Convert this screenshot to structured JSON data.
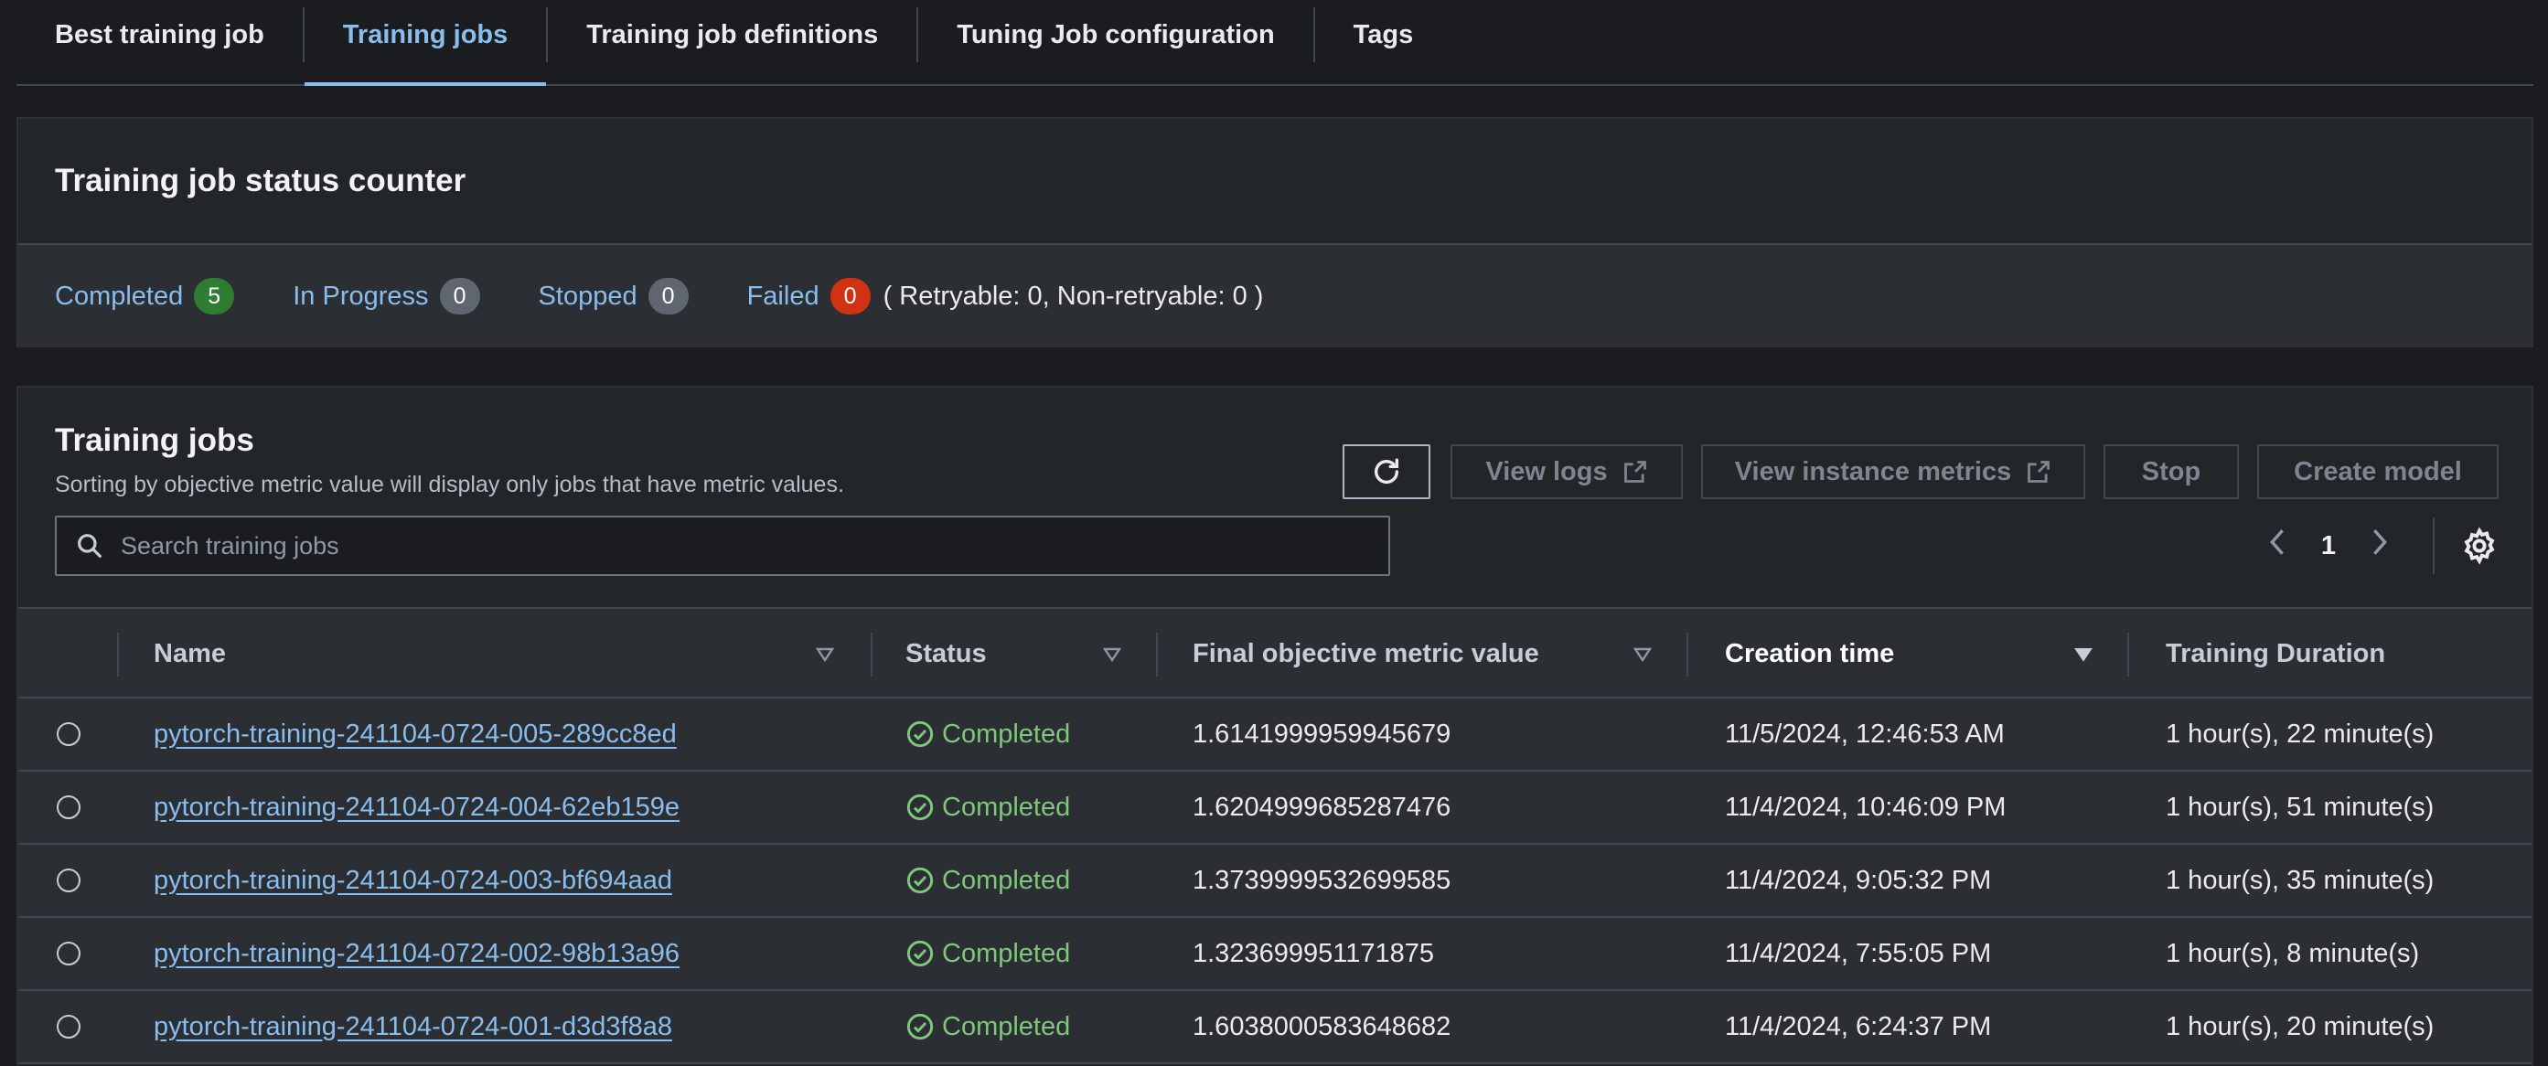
{
  "tabs": [
    {
      "label": "Best training job",
      "active": false
    },
    {
      "label": "Training jobs",
      "active": true
    },
    {
      "label": "Training job definitions",
      "active": false
    },
    {
      "label": "Tuning Job configuration",
      "active": false
    },
    {
      "label": "Tags",
      "active": false
    }
  ],
  "status_counter": {
    "title": "Training job status counter",
    "completed": {
      "label": "Completed",
      "count": "5"
    },
    "in_progress": {
      "label": "In Progress",
      "count": "0"
    },
    "stopped": {
      "label": "Stopped",
      "count": "0"
    },
    "failed": {
      "label": "Failed",
      "count": "0"
    },
    "retry_text": "( Retryable: 0, Non-retryable: 0 )"
  },
  "jobs": {
    "title": "Training jobs",
    "description": "Sorting by objective metric value will display only jobs that have metric values.",
    "buttons": {
      "view_logs": "View logs",
      "view_metrics": "View instance metrics",
      "stop": "Stop",
      "create_model": "Create model"
    },
    "search_placeholder": "Search training jobs",
    "page": "1",
    "columns": {
      "name": "Name",
      "status": "Status",
      "metric": "Final objective metric value",
      "created": "Creation time",
      "duration": "Training Duration"
    },
    "rows": [
      {
        "name": "pytorch-training-241104-0724-005-289cc8ed",
        "status": "Completed",
        "metric": "1.6141999959945679",
        "created": "11/5/2024, 12:46:53 AM",
        "duration": "1 hour(s), 22 minute(s)"
      },
      {
        "name": "pytorch-training-241104-0724-004-62eb159e",
        "status": "Completed",
        "metric": "1.6204999685287476",
        "created": "11/4/2024, 10:46:09 PM",
        "duration": "1 hour(s), 51 minute(s)"
      },
      {
        "name": "pytorch-training-241104-0724-003-bf694aad",
        "status": "Completed",
        "metric": "1.3739999532699585",
        "created": "11/4/2024, 9:05:32 PM",
        "duration": "1 hour(s), 35 minute(s)"
      },
      {
        "name": "pytorch-training-241104-0724-002-98b13a96",
        "status": "Completed",
        "metric": "1.323699951171875",
        "created": "11/4/2024, 7:55:05 PM",
        "duration": "1 hour(s), 8 minute(s)"
      },
      {
        "name": "pytorch-training-241104-0724-001-d3d3f8a8",
        "status": "Completed",
        "metric": "1.6038000583648682",
        "created": "11/4/2024, 6:24:37 PM",
        "duration": "1 hour(s), 20 minute(s)"
      }
    ]
  },
  "colors": {
    "accent_blue": "#89bdee",
    "success_green": "#7fc87a",
    "badge_green": "#2e7d32",
    "badge_red": "#d13212",
    "badge_grey": "#5f6670"
  }
}
